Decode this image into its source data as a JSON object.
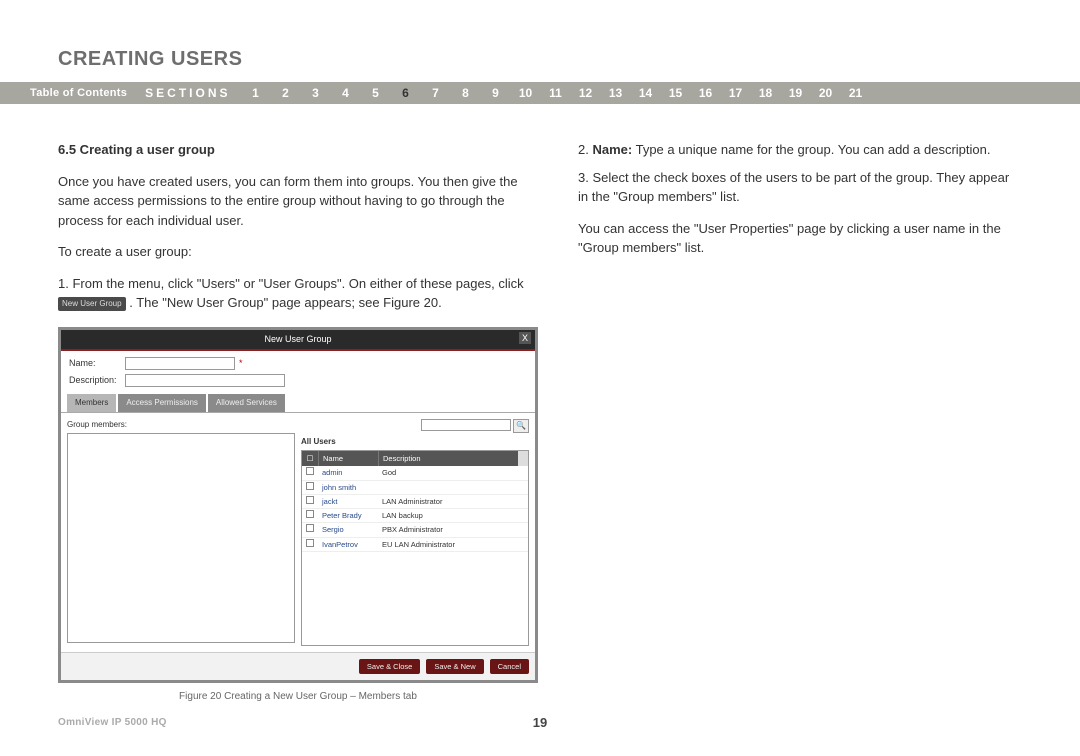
{
  "header": {
    "title": "CREATING USERS"
  },
  "nav": {
    "toc": "Table of Contents",
    "sections_label": "SECTIONS",
    "items": [
      "1",
      "2",
      "3",
      "4",
      "5",
      "6",
      "7",
      "8",
      "9",
      "10",
      "11",
      "12",
      "13",
      "14",
      "15",
      "16",
      "17",
      "18",
      "19",
      "20",
      "21"
    ],
    "active": "6"
  },
  "left": {
    "heading": "6.5 Creating a user group",
    "p1": "Once you have created users, you can form them into groups. You then give the same access permissions to the entire group without having to go through the process for each individual user.",
    "p2": "To create a user group:",
    "step1_a": "1. From the menu, click \"Users\" or \"User Groups\". On either of these pages, click ",
    "step1_btn": "New User Group",
    "step1_b": " . The \"New User Group\" page appears; see Figure 20."
  },
  "right": {
    "step2_label": "2. ",
    "step2_bold": "Name:",
    "step2_rest": " Type a unique name for the group. You can add a description.",
    "step3": "3. Select the check boxes of the users to be part of the group. They appear in the \"Group members\" list.",
    "p_access": "You can access the \"User Properties\" page by clicking a user name in the \"Group members\" list."
  },
  "figure": {
    "title": "New User Group",
    "close": "X",
    "name_label": "Name:",
    "name_req": "*",
    "desc_label": "Description:",
    "tabs": [
      "Members",
      "Access Permissions",
      "Allowed Services"
    ],
    "group_members": "Group members:",
    "all_users": "All Users",
    "th_name": "Name",
    "th_desc": "Description",
    "rows": [
      {
        "name": "admin",
        "desc": "God"
      },
      {
        "name": "john smith",
        "desc": ""
      },
      {
        "name": "jackt",
        "desc": "LAN Administrator"
      },
      {
        "name": "Peter Brady",
        "desc": "LAN backup"
      },
      {
        "name": "Sergio",
        "desc": "PBX Administrator"
      },
      {
        "name": "IvanPetrov",
        "desc": "EU LAN Administrator"
      }
    ],
    "search_icon": "🔍",
    "btn_save_close": "Save & Close",
    "btn_save_new": "Save & New",
    "btn_cancel": "Cancel",
    "caption": "Figure 20 Creating a New User Group – Members tab"
  },
  "footer": {
    "product": "OmniView IP 5000 HQ",
    "page": "19"
  }
}
